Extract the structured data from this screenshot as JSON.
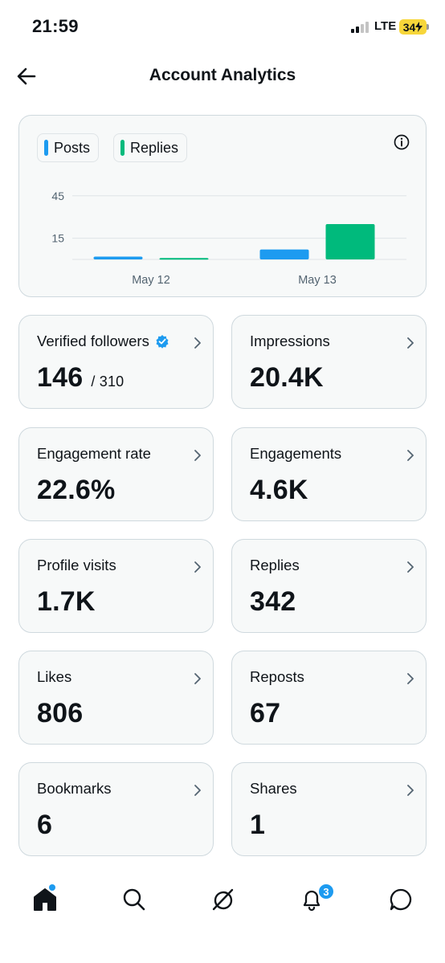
{
  "status_bar": {
    "time": "21:59",
    "network": "LTE",
    "battery": "34"
  },
  "header": {
    "title": "Account Analytics"
  },
  "colors": {
    "posts": "#1d9bf0",
    "replies": "#00ba7c",
    "accent": "#1d9bf0"
  },
  "chart_data": {
    "type": "bar",
    "categories": [
      "May 12",
      "May 13"
    ],
    "series": [
      {
        "name": "Posts",
        "values": [
          2,
          7
        ]
      },
      {
        "name": "Replies",
        "values": [
          1,
          25
        ]
      }
    ],
    "yticks": [
      "45",
      "15"
    ],
    "ylim": [
      0,
      50
    ],
    "grid": true,
    "legend": "top-left"
  },
  "stats": [
    {
      "label": "Verified followers",
      "value": "146",
      "sub": "/ 310"
    },
    {
      "label": "Impressions",
      "value": "20.4K"
    },
    {
      "label": "Engagement rate",
      "value": "22.6%"
    },
    {
      "label": "Engagements",
      "value": "4.6K"
    },
    {
      "label": "Profile visits",
      "value": "1.7K"
    },
    {
      "label": "Replies",
      "value": "342"
    },
    {
      "label": "Likes",
      "value": "806"
    },
    {
      "label": "Reposts",
      "value": "67"
    },
    {
      "label": "Bookmarks",
      "value": "6"
    },
    {
      "label": "Shares",
      "value": "1"
    }
  ],
  "nav": {
    "items": [
      "home-icon",
      "search-icon",
      "grok-icon",
      "notifications-icon",
      "messages-icon"
    ],
    "notifications_badge": "3"
  }
}
